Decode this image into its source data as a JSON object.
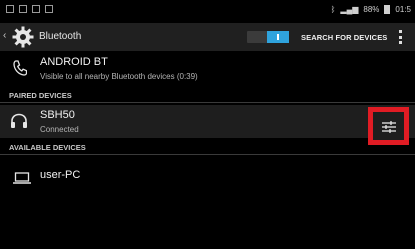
{
  "status_bar": {
    "battery_percent": "88%",
    "time": "01:5"
  },
  "action_bar": {
    "title": "Bluetooth",
    "bluetooth_on": true,
    "search_button_label": "SEARCH FOR DEVICES"
  },
  "this_device": {
    "name": "ANDROID BT",
    "status": "Visible to all nearby Bluetooth devices (0:39)"
  },
  "paired_section": {
    "header": "PAIRED DEVICES",
    "devices": [
      {
        "name": "SBH50",
        "status": "Connected",
        "icon": "headphones-icon"
      }
    ]
  },
  "available_section": {
    "header": "AVAILABLE DEVICES",
    "devices": [
      {
        "name": "user-PC",
        "icon": "laptop-icon"
      }
    ]
  },
  "colors": {
    "accent": "#2fa3dd",
    "highlight": "#e01c24"
  }
}
